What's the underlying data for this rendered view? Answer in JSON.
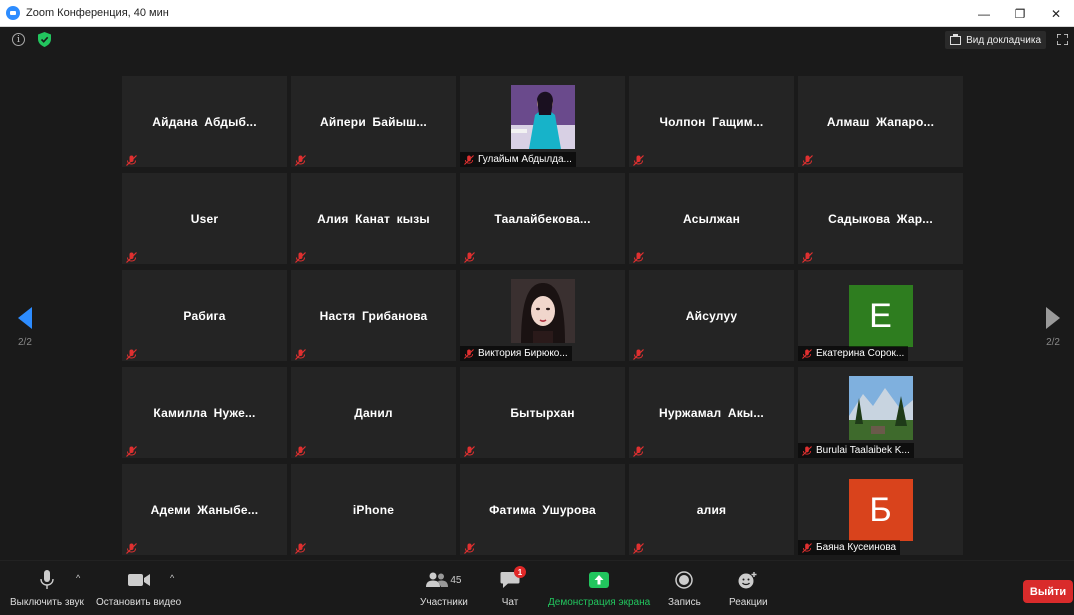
{
  "window": {
    "title": "Zoom Конференция, 40 мин",
    "minimize": "—",
    "restore": "❐",
    "close": "✕"
  },
  "topbar": {
    "info_glyph": "i",
    "speaker_view": "Вид докладчика"
  },
  "pages": {
    "left": "2/2",
    "right": "2/2"
  },
  "colors": {
    "accent": "#2d8cff",
    "muted_red": "#e03030",
    "leave": "#d92b2b",
    "share_green": "#22c55e"
  },
  "participants": [
    {
      "name": "Айдана  Абдыб...",
      "type": "name"
    },
    {
      "name": "Айпери  Байыш...",
      "type": "name"
    },
    {
      "name": "Гулайым Абдылда...",
      "type": "video",
      "photo": "portrait-blue"
    },
    {
      "name": "Чолпон  Гащим...",
      "type": "name"
    },
    {
      "name": "Алмаш  Жапаро...",
      "type": "name"
    },
    {
      "name": "User",
      "type": "name"
    },
    {
      "name": "Алия Канат кызы",
      "type": "name"
    },
    {
      "name": "Таалайбекова...",
      "type": "name"
    },
    {
      "name": "Асылжан",
      "type": "name"
    },
    {
      "name": "Садыкова  Жар...",
      "type": "name"
    },
    {
      "name": "Рабига",
      "type": "name"
    },
    {
      "name": "Настя Грибанова",
      "type": "name"
    },
    {
      "name": "Виктория Бирюко...",
      "type": "video",
      "photo": "portrait-dark"
    },
    {
      "name": "Айсулуу",
      "type": "name"
    },
    {
      "name": "Екатерина Сорок...",
      "type": "avatar",
      "letter": "Е",
      "color": "#2e7d1f"
    },
    {
      "name": "Камилла  Нуже...",
      "type": "name"
    },
    {
      "name": "Данил",
      "type": "name"
    },
    {
      "name": "Бытырхан",
      "type": "name"
    },
    {
      "name": "Нуржамал  Акы...",
      "type": "name"
    },
    {
      "name": "Burulai Taalaibek K...",
      "type": "video",
      "photo": "landscape"
    },
    {
      "name": "Адеми  Жаныбе...",
      "type": "name"
    },
    {
      "name": "iPhone",
      "type": "name"
    },
    {
      "name": "Фатима Ушурова",
      "type": "name"
    },
    {
      "name": "алия",
      "type": "name"
    },
    {
      "name": "Баяна Кусеинова",
      "type": "avatar",
      "letter": "Б",
      "color": "#d9431c"
    }
  ],
  "toolbar": {
    "mute_label": "Выключить звук",
    "video_label": "Остановить видео",
    "participants_label": "Участники",
    "participants_count": "45",
    "chat_label": "Чат",
    "chat_badge": "1",
    "share_label": "Демонстрация экрана",
    "record_label": "Запись",
    "reactions_label": "Реакции",
    "leave_label": "Выйти",
    "caret": "^"
  }
}
